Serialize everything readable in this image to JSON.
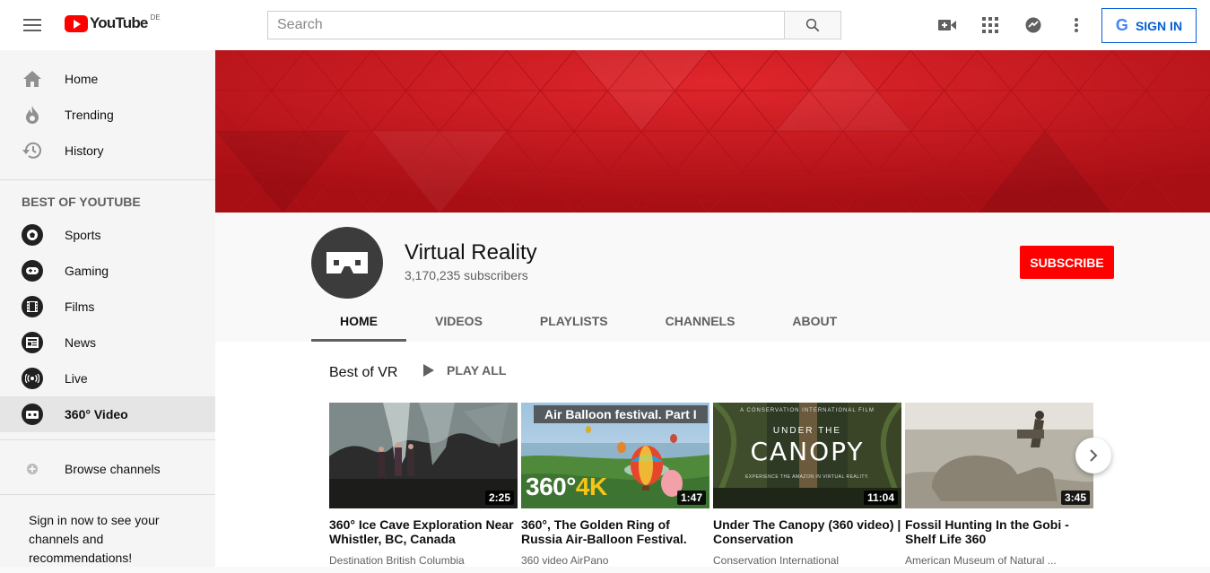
{
  "header": {
    "logo_text": "YouTube",
    "region": "DE",
    "search_placeholder": "Search",
    "signin_label": "SIGN IN",
    "google_g": "G"
  },
  "sidebar": {
    "main": [
      {
        "label": "Home",
        "icon": "home-icon"
      },
      {
        "label": "Trending",
        "icon": "flame-icon"
      },
      {
        "label": "History",
        "icon": "history-icon"
      }
    ],
    "best_heading": "BEST OF YOUTUBE",
    "best": [
      {
        "label": "Sports",
        "icon": "sports-icon"
      },
      {
        "label": "Gaming",
        "icon": "gaming-icon"
      },
      {
        "label": "Films",
        "icon": "films-icon"
      },
      {
        "label": "News",
        "icon": "news-icon"
      },
      {
        "label": "Live",
        "icon": "live-icon"
      },
      {
        "label": "360° Video",
        "icon": "vr-icon",
        "active": true
      }
    ],
    "browse": "Browse channels",
    "signin_note": "Sign in now to see your channels and recommendations!"
  },
  "channel": {
    "name": "Virtual Reality",
    "subscribers": "3,170,235 subscribers",
    "subscribe_label": "SUBSCRIBE",
    "tabs": [
      "HOME",
      "VIDEOS",
      "PLAYLISTS",
      "CHANNELS",
      "ABOUT"
    ],
    "active_tab": "HOME"
  },
  "shelf": {
    "title": "Best of VR",
    "play_all": "PLAY ALL",
    "videos": [
      {
        "title": "360° Ice Cave Exploration Near Whistler, BC, Canada",
        "channel": "Destination British Columbia",
        "duration": "2:25"
      },
      {
        "title": "360°, The Golden Ring of Russia Air-Balloon Festival.",
        "channel": "360 video AirPano",
        "duration": "1:47",
        "overlay_label": "Air Balloon festival. Part I",
        "overlay_big": "360°",
        "overlay_big_accent": "4K"
      },
      {
        "title": "Under The Canopy (360 video) | Conservation",
        "channel": "Conservation International",
        "duration": "11:04",
        "overlay_top": "A CONSERVATION INTERNATIONAL FILM",
        "overlay_word": "UNDER THE",
        "overlay_big": "CANOPY",
        "overlay_sub": "EXPERIENCE THE AMAZON IN VIRTUAL REALITY."
      },
      {
        "title": "Fossil Hunting In the Gobi - Shelf Life 360",
        "channel": "American Museum of Natural ...",
        "duration": "3:45"
      }
    ]
  }
}
